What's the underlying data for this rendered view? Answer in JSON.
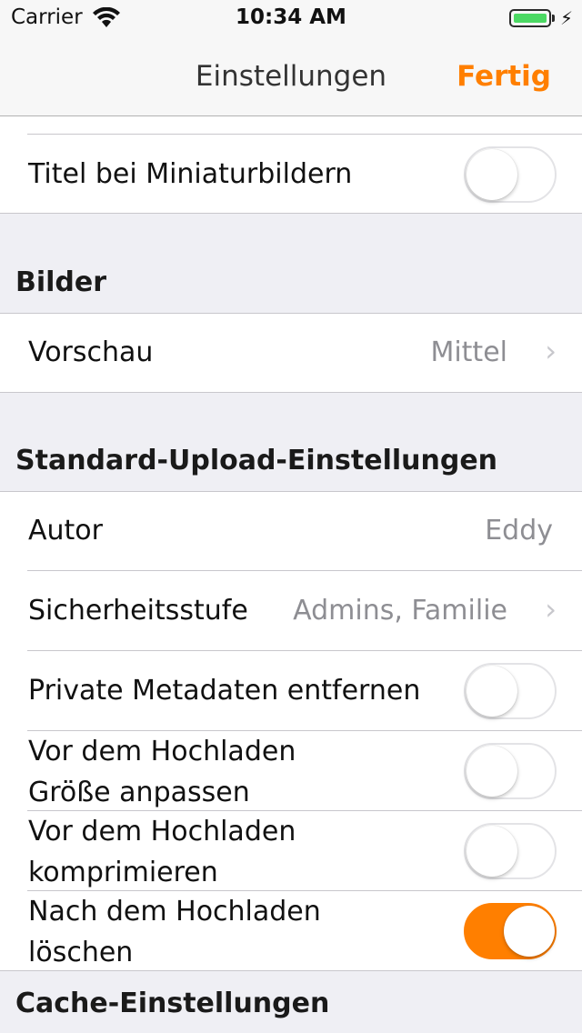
{
  "status_bar": {
    "carrier": "Carrier",
    "time": "10:34 AM",
    "battery_color": "#4cd964"
  },
  "nav": {
    "title": "Einstellungen",
    "done_label": "Fertig",
    "accent_color": "#ff7f00"
  },
  "rows": {
    "thumbnail_titles": {
      "label": "Titel bei Miniaturbildern",
      "toggle_on": false
    }
  },
  "sections": {
    "images": {
      "header": "Bilder",
      "preview": {
        "label": "Vorschau",
        "value": "Mittel"
      }
    },
    "upload": {
      "header": "Standard-Upload-Einstellungen",
      "author": {
        "label": "Autor",
        "value": "Eddy"
      },
      "privacy": {
        "label": "Sicherheitsstufe",
        "value": "Admins, Familie"
      },
      "strip_metadata": {
        "label": "Private Metadaten entfernen",
        "toggle_on": false
      },
      "resize": {
        "label_line1": "Vor dem Hochladen",
        "label_line2": "Größe anpassen",
        "toggle_on": false
      },
      "compress": {
        "label_line1": "Vor dem Hochladen",
        "label_line2": "komprimieren",
        "toggle_on": false
      },
      "delete_after": {
        "label_line1": "Nach dem Hochladen",
        "label_line2": "löschen",
        "toggle_on": true
      }
    },
    "cache": {
      "header": "Cache-Einstellungen"
    }
  }
}
